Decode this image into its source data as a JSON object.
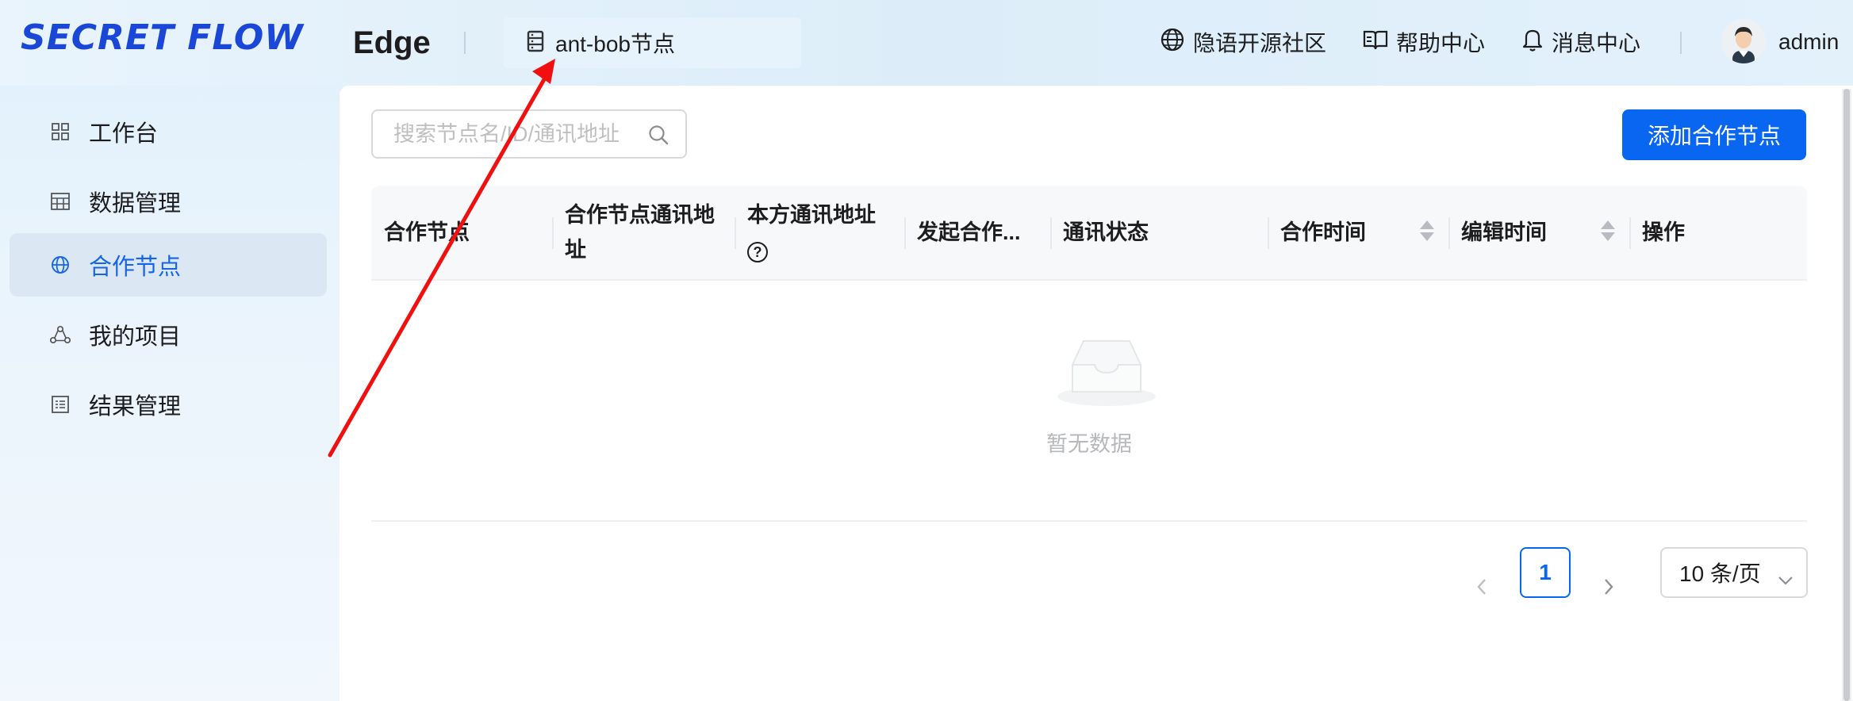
{
  "app": {
    "logo_text": "SECRET FLOW",
    "edition": "Edge",
    "node_chip": {
      "icon": "server-icon",
      "label": "ant-bob节点"
    }
  },
  "header_links": [
    {
      "icon": "globe-icon",
      "label": "隐语开源社区"
    },
    {
      "icon": "book-icon",
      "label": "帮助中心"
    },
    {
      "icon": "bell-icon",
      "label": "消息中心"
    }
  ],
  "user": {
    "name": "admin",
    "icon": "avatar"
  },
  "sidebar": {
    "items": [
      {
        "icon": "grid-icon",
        "label": "工作台",
        "active": false
      },
      {
        "icon": "table-icon",
        "label": "数据管理",
        "active": false
      },
      {
        "icon": "globe-icon",
        "label": "合作节点",
        "active": true
      },
      {
        "icon": "share-icon",
        "label": "我的项目",
        "active": false
      },
      {
        "icon": "list-icon",
        "label": "结果管理",
        "active": false
      }
    ]
  },
  "main": {
    "search": {
      "placeholder": "搜索节点名/ID/通讯地址",
      "value": ""
    },
    "add_button": "添加合作节点",
    "table": {
      "columns": [
        {
          "label": "合作节点"
        },
        {
          "label": "合作节点通讯地址"
        },
        {
          "label": "本方通讯地址"
        },
        {
          "label": "发起合作..."
        },
        {
          "label": "通讯状态"
        },
        {
          "label": "合作时间",
          "sortable": true
        },
        {
          "label": "编辑时间",
          "sortable": true
        },
        {
          "label": "操作"
        }
      ],
      "rows": [],
      "empty_text": "暂无数据"
    },
    "pagination": {
      "current_page": "1",
      "page_size": "10 条/页"
    }
  },
  "colors": {
    "primary": "#0866f0",
    "logo": "#1a47d6",
    "annotation_arrow": "#f01010"
  }
}
